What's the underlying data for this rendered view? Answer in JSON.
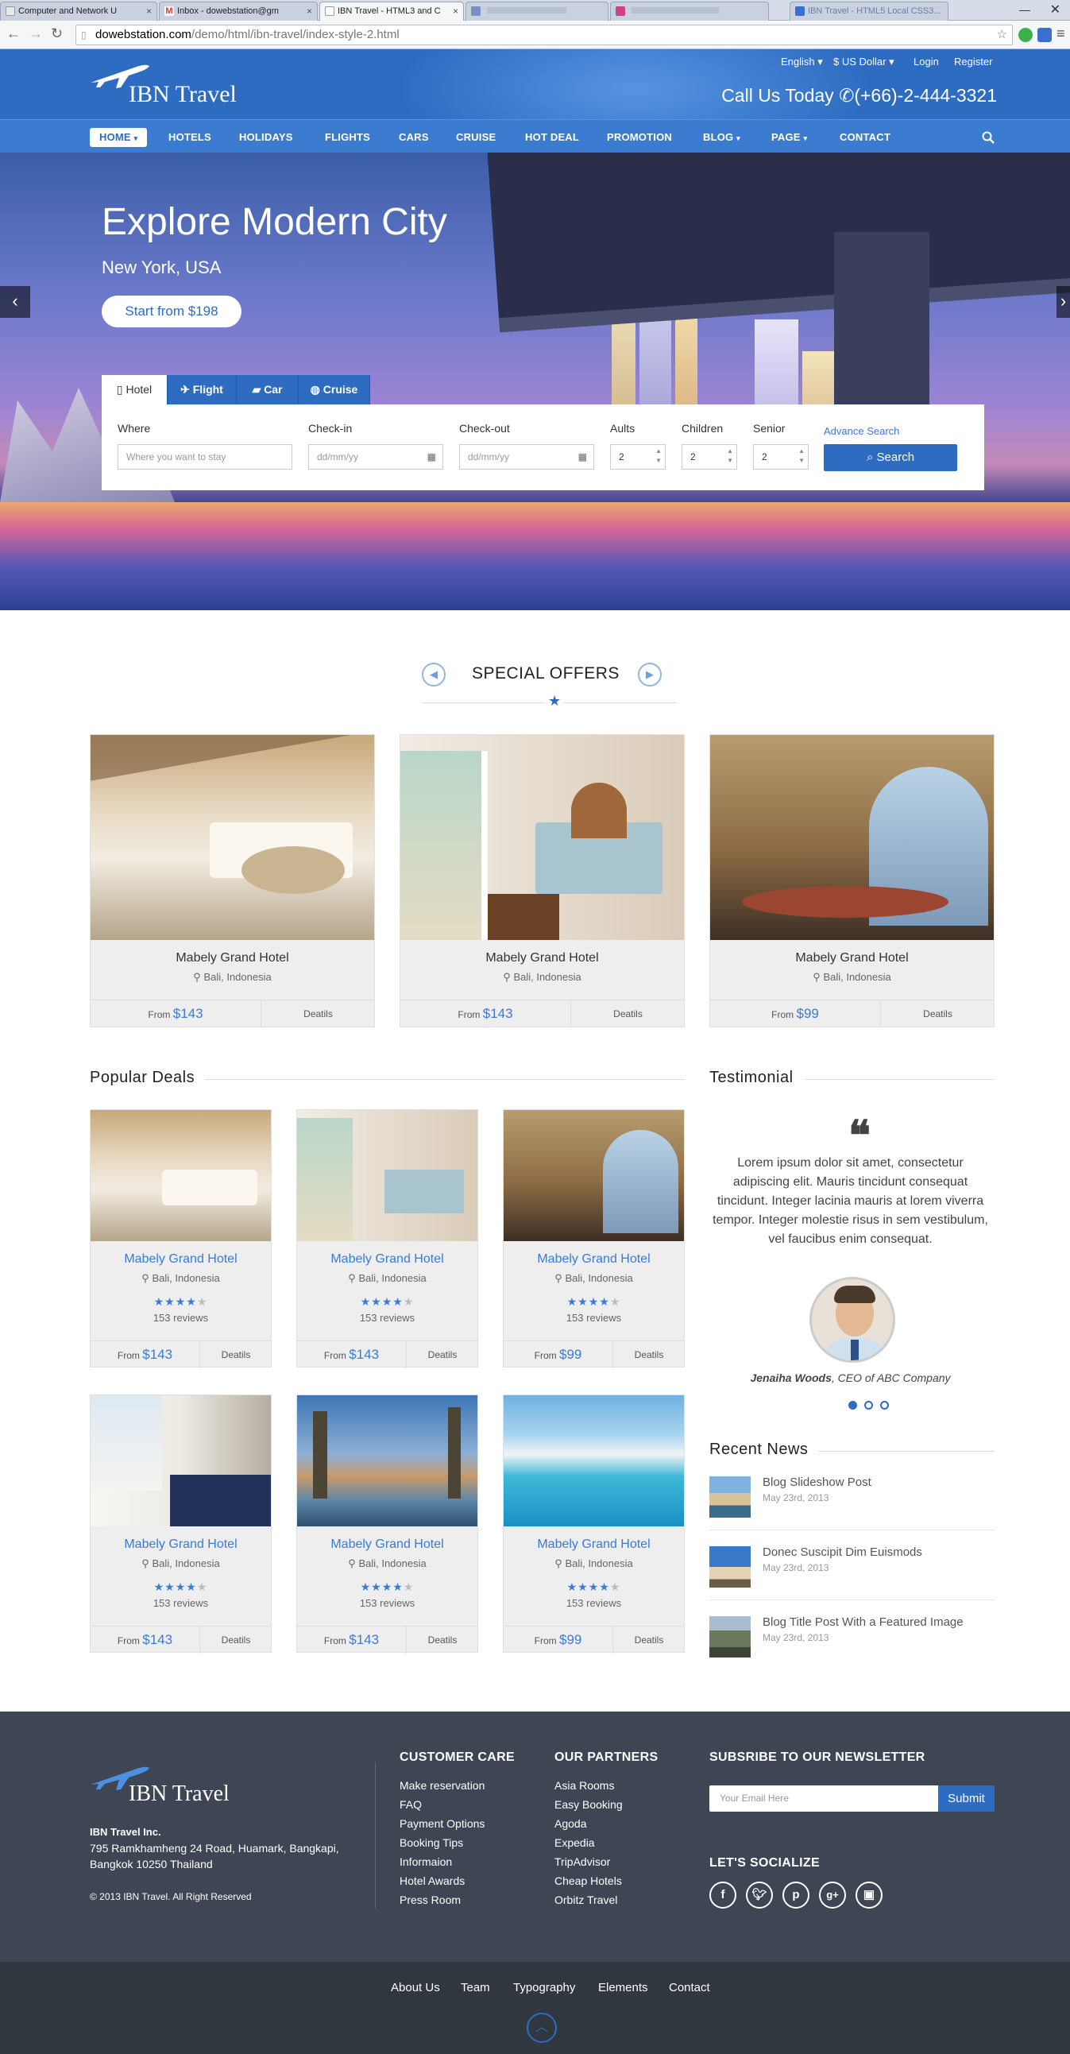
{
  "browser": {
    "tabs": [
      {
        "title": "Computer and Network U",
        "active": false
      },
      {
        "title": "Inbox - dowebstation@gm",
        "active": false
      },
      {
        "title": "IBN Travel - HTML3 and C",
        "active": true
      },
      {
        "title": "",
        "active": false
      },
      {
        "title": "",
        "active": false
      },
      {
        "title": "IBN Travel - HTML5 Local CSS3...",
        "active": false
      }
    ],
    "url_domain": "dowebstation.com",
    "url_path": "/demo/html/ibn-travel/index-style-2.html"
  },
  "header": {
    "logo": "IBN Travel",
    "language": "English",
    "currency": "$ US Dollar",
    "login": "Login",
    "register": "Register",
    "call_label": "Call Us Today",
    "phone": "(+66)-2-444-3321"
  },
  "menu": [
    {
      "label": "HOME",
      "dropdown": true,
      "active": true
    },
    {
      "label": "HOTELS",
      "dropdown": false,
      "active": false
    },
    {
      "label": "HOLIDAYS",
      "dropdown": false,
      "active": false
    },
    {
      "label": "FLIGHTS",
      "dropdown": false,
      "active": false
    },
    {
      "label": "CARS",
      "dropdown": false,
      "active": false
    },
    {
      "label": "CRUISE",
      "dropdown": false,
      "active": false
    },
    {
      "label": "HOT DEAL",
      "dropdown": false,
      "active": false
    },
    {
      "label": "PROMOTION",
      "dropdown": false,
      "active": false
    },
    {
      "label": "BLOG",
      "dropdown": true,
      "active": false
    },
    {
      "label": "PAGE",
      "dropdown": true,
      "active": false
    },
    {
      "label": "CONTACT",
      "dropdown": false,
      "active": false
    }
  ],
  "hero": {
    "title": "Explore Modern City",
    "subtitle": "New York, USA",
    "button": "Start from $198"
  },
  "search": {
    "tabs": [
      "Hotel",
      "Flight",
      "Car",
      "Cruise"
    ],
    "where_label": "Where",
    "where_placeholder": "Where you want to stay",
    "checkin_label": "Check-in",
    "checkin_placeholder": "dd/mm/yy",
    "checkout_label": "Check-out",
    "checkout_placeholder": "dd/mm/yy",
    "adults_label": "Aults",
    "adults_value": "2",
    "children_label": "Children",
    "children_value": "2",
    "senior_label": "Senior",
    "senior_value": "2",
    "advance": "Advance Search",
    "button": "Search"
  },
  "special_offers": {
    "title": "SPECIAL OFFERS",
    "items": [
      {
        "name": "Mabely Grand Hotel",
        "location": "Bali, Indonesia",
        "from": "From",
        "price": "$143",
        "details": "Deatils"
      },
      {
        "name": "Mabely Grand Hotel",
        "location": "Bali, Indonesia",
        "from": "From",
        "price": "$143",
        "details": "Deatils"
      },
      {
        "name": "Mabely Grand Hotel",
        "location": "Bali, Indonesia",
        "from": "From",
        "price": "$99",
        "details": "Deatils"
      }
    ]
  },
  "popular_deals": {
    "title": "Popular Deals",
    "items": [
      {
        "name": "Mabely Grand Hotel",
        "location": "Bali, Indonesia",
        "rating": 4,
        "reviews": "153 reviews",
        "from": "From",
        "price": "$143",
        "details": "Deatils"
      },
      {
        "name": "Mabely Grand Hotel",
        "location": "Bali, Indonesia",
        "rating": 4,
        "reviews": "153 reviews",
        "from": "From",
        "price": "$143",
        "details": "Deatils"
      },
      {
        "name": "Mabely Grand Hotel",
        "location": "Bali, Indonesia",
        "rating": 4,
        "reviews": "153 reviews",
        "from": "From",
        "price": "$99",
        "details": "Deatils"
      },
      {
        "name": "Mabely Grand Hotel",
        "location": "Bali, Indonesia",
        "rating": 4,
        "reviews": "153 reviews",
        "from": "From",
        "price": "$143",
        "details": "Deatils"
      },
      {
        "name": "Mabely Grand Hotel",
        "location": "Bali, Indonesia",
        "rating": 4,
        "reviews": "153 reviews",
        "from": "From",
        "price": "$143",
        "details": "Deatils"
      },
      {
        "name": "Mabely Grand Hotel",
        "location": "Bali, Indonesia",
        "rating": 4,
        "reviews": "153 reviews",
        "from": "From",
        "price": "$99",
        "details": "Deatils"
      }
    ]
  },
  "testimonial": {
    "title": "Testimonial",
    "text": "Lorem ipsum dolor sit amet, consectetur adipiscing elit. Mauris tincidunt consequat tincidunt. Integer lacinia mauris at lorem viverra tempor. Integer molestie risus in sem vestibulum, vel faucibus enim consequat.",
    "name": "Jenaiha Woods",
    "role": ", CEO of ABC Company"
  },
  "recent_news": {
    "title": "Recent News",
    "items": [
      {
        "title": "Blog Slideshow Post",
        "date": "May 23rd, 2013"
      },
      {
        "title": "Donec Suscipit Dim Euismods",
        "date": "May 23rd, 2013"
      },
      {
        "title": "Blog Title Post With a Featured Image",
        "date": "May 23rd, 2013"
      }
    ]
  },
  "footer": {
    "logo": "IBN Travel",
    "company": "IBN Travel Inc.",
    "address1": "795 Ramkhamheng 24 Road, Huamark, Bangkapi,",
    "address2": "Bangkok 10250 Thailand",
    "copyright": "© 2013 IBN Travel. All Right Reserved",
    "customer_care_title": "CUSTOMER CARE",
    "customer_care": [
      "Make reservation",
      "FAQ",
      "Payment Options",
      "Booking Tips",
      "Informaion",
      "Hotel Awards",
      "Press Room"
    ],
    "partners_title": "OUR PARTNERS",
    "partners": [
      "Asia Rooms",
      "Easy Booking",
      "Agoda",
      "Expedia",
      "TripAdvisor",
      "Cheap Hotels",
      "Orbitz Travel"
    ],
    "newsletter_title": "SUBSRIBE TO OUR NEWSLETTER",
    "email_placeholder": "Your Email Here",
    "submit": "Submit",
    "social_title": "LET'S SOCIALIZE",
    "social": [
      "f",
      "t",
      "p",
      "g+",
      "ig"
    ],
    "bottom_links": [
      "About Us",
      "Team",
      "Typography",
      "Elements",
      "Contact"
    ]
  },
  "colors": {
    "brand": "#2d6cc0",
    "footer": "#3d4652",
    "footer_bottom": "#30373f",
    "link": "#3a7bd5"
  }
}
